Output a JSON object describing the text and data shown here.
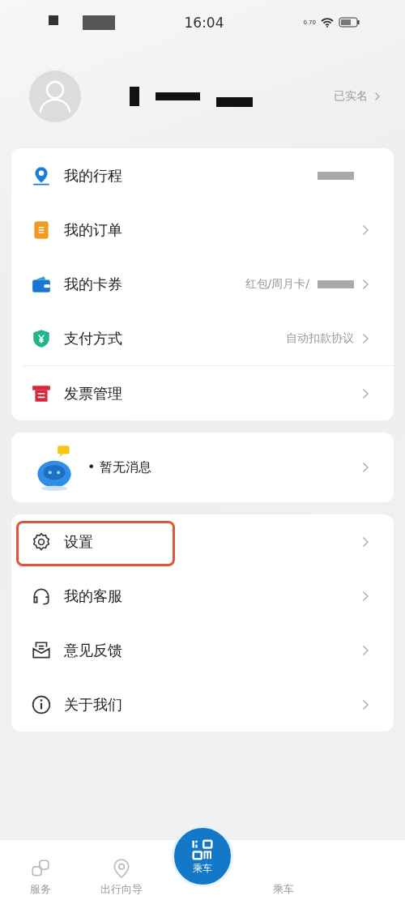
{
  "status_bar": {
    "time": "16:04",
    "speed": "0.70"
  },
  "profile": {
    "verify_label": "已实名"
  },
  "menu_main": [
    {
      "label": "我的行程",
      "redacted": true,
      "arrow": false
    },
    {
      "label": "我的订单",
      "redacted": false,
      "arrow": true
    },
    {
      "label": "我的卡券",
      "value": "红包/周月卡/",
      "redacted": true,
      "arrow": true
    },
    {
      "label": "支付方式",
      "value": "自动扣款协议",
      "redacted": false,
      "arrow": true
    },
    {
      "label": "发票管理",
      "redacted": false,
      "arrow": true
    }
  ],
  "message": {
    "text": "• 暂无消息"
  },
  "menu_more": [
    {
      "label": "设置",
      "highlighted": true
    },
    {
      "label": "我的客服",
      "highlighted": false
    },
    {
      "label": "意见反馈",
      "highlighted": false
    },
    {
      "label": "关于我们",
      "highlighted": false
    }
  ],
  "tabbar": [
    {
      "label": "服务",
      "kind": "tab"
    },
    {
      "label": "出行向导",
      "kind": "tab"
    },
    {
      "label": "乘车",
      "kind": "center"
    },
    {
      "label": "乘车",
      "kind": "tab"
    }
  ]
}
